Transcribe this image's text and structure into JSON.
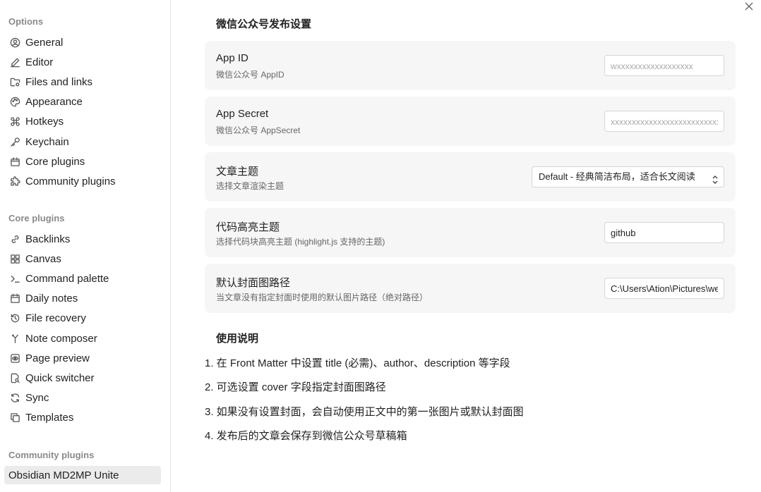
{
  "sidebar": {
    "options_title": "Options",
    "options": [
      {
        "label": "General",
        "icon": "user-circle-icon"
      },
      {
        "label": "Editor",
        "icon": "pencil-icon"
      },
      {
        "label": "Files and links",
        "icon": "folder-cog-icon"
      },
      {
        "label": "Appearance",
        "icon": "palette-icon"
      },
      {
        "label": "Hotkeys",
        "icon": "command-icon"
      },
      {
        "label": "Keychain",
        "icon": "key-icon"
      },
      {
        "label": "Core plugins",
        "icon": "plug-icon"
      },
      {
        "label": "Community plugins",
        "icon": "puzzle-icon"
      }
    ],
    "core_title": "Core plugins",
    "core": [
      {
        "label": "Backlinks",
        "icon": "link-icon"
      },
      {
        "label": "Canvas",
        "icon": "layout-grid-icon"
      },
      {
        "label": "Command palette",
        "icon": "terminal-icon"
      },
      {
        "label": "Daily notes",
        "icon": "calendar-icon"
      },
      {
        "label": "File recovery",
        "icon": "history-icon"
      },
      {
        "label": "Note composer",
        "icon": "merge-icon"
      },
      {
        "label": "Page preview",
        "icon": "eye-icon"
      },
      {
        "label": "Quick switcher",
        "icon": "file-search-icon"
      },
      {
        "label": "Sync",
        "icon": "sync-icon"
      },
      {
        "label": "Templates",
        "icon": "copy-icon"
      }
    ],
    "community_title": "Community plugins",
    "community": [
      {
        "label": "Obsidian MD2MP Unite",
        "active": true
      }
    ]
  },
  "main": {
    "section_title": "微信公众号发布设置",
    "settings": [
      {
        "name": "App ID",
        "desc": "微信公众号 AppID",
        "type": "input",
        "value": "",
        "placeholder": "wxxxxxxxxxxxxxxxxxx"
      },
      {
        "name": "App Secret",
        "desc": "微信公众号 AppSecret",
        "type": "input",
        "value": "",
        "placeholder": "xxxxxxxxxxxxxxxxxxxxxxxxxxxxxxxx"
      },
      {
        "name": "文章主题",
        "desc": "选择文章渲染主题",
        "type": "select",
        "value": "Default - 经典简洁布局，适合长文阅读"
      },
      {
        "name": "代码高亮主题",
        "desc": "选择代码块高亮主题 (highlight.js 支持的主题)",
        "type": "input",
        "value": "github",
        "placeholder": ""
      },
      {
        "name": "默认封面图路径",
        "desc": "当文章没有指定封面时使用的默认图片路径（绝对路径）",
        "type": "input",
        "value": "C:\\Users\\Ation\\Pictures\\wechat_cover.png",
        "placeholder": ""
      }
    ],
    "usage_title": "使用说明",
    "usage": [
      "1. 在 Front Matter 中设置 title (必需)、author、description 等字段",
      "2. 可选设置 cover 字段指定封面图路径",
      "3. 如果没有设置封面，会自动使用正文中的第一张图片或默认封面图",
      "4. 发布后的文章会保存到微信公众号草稿箱"
    ]
  }
}
